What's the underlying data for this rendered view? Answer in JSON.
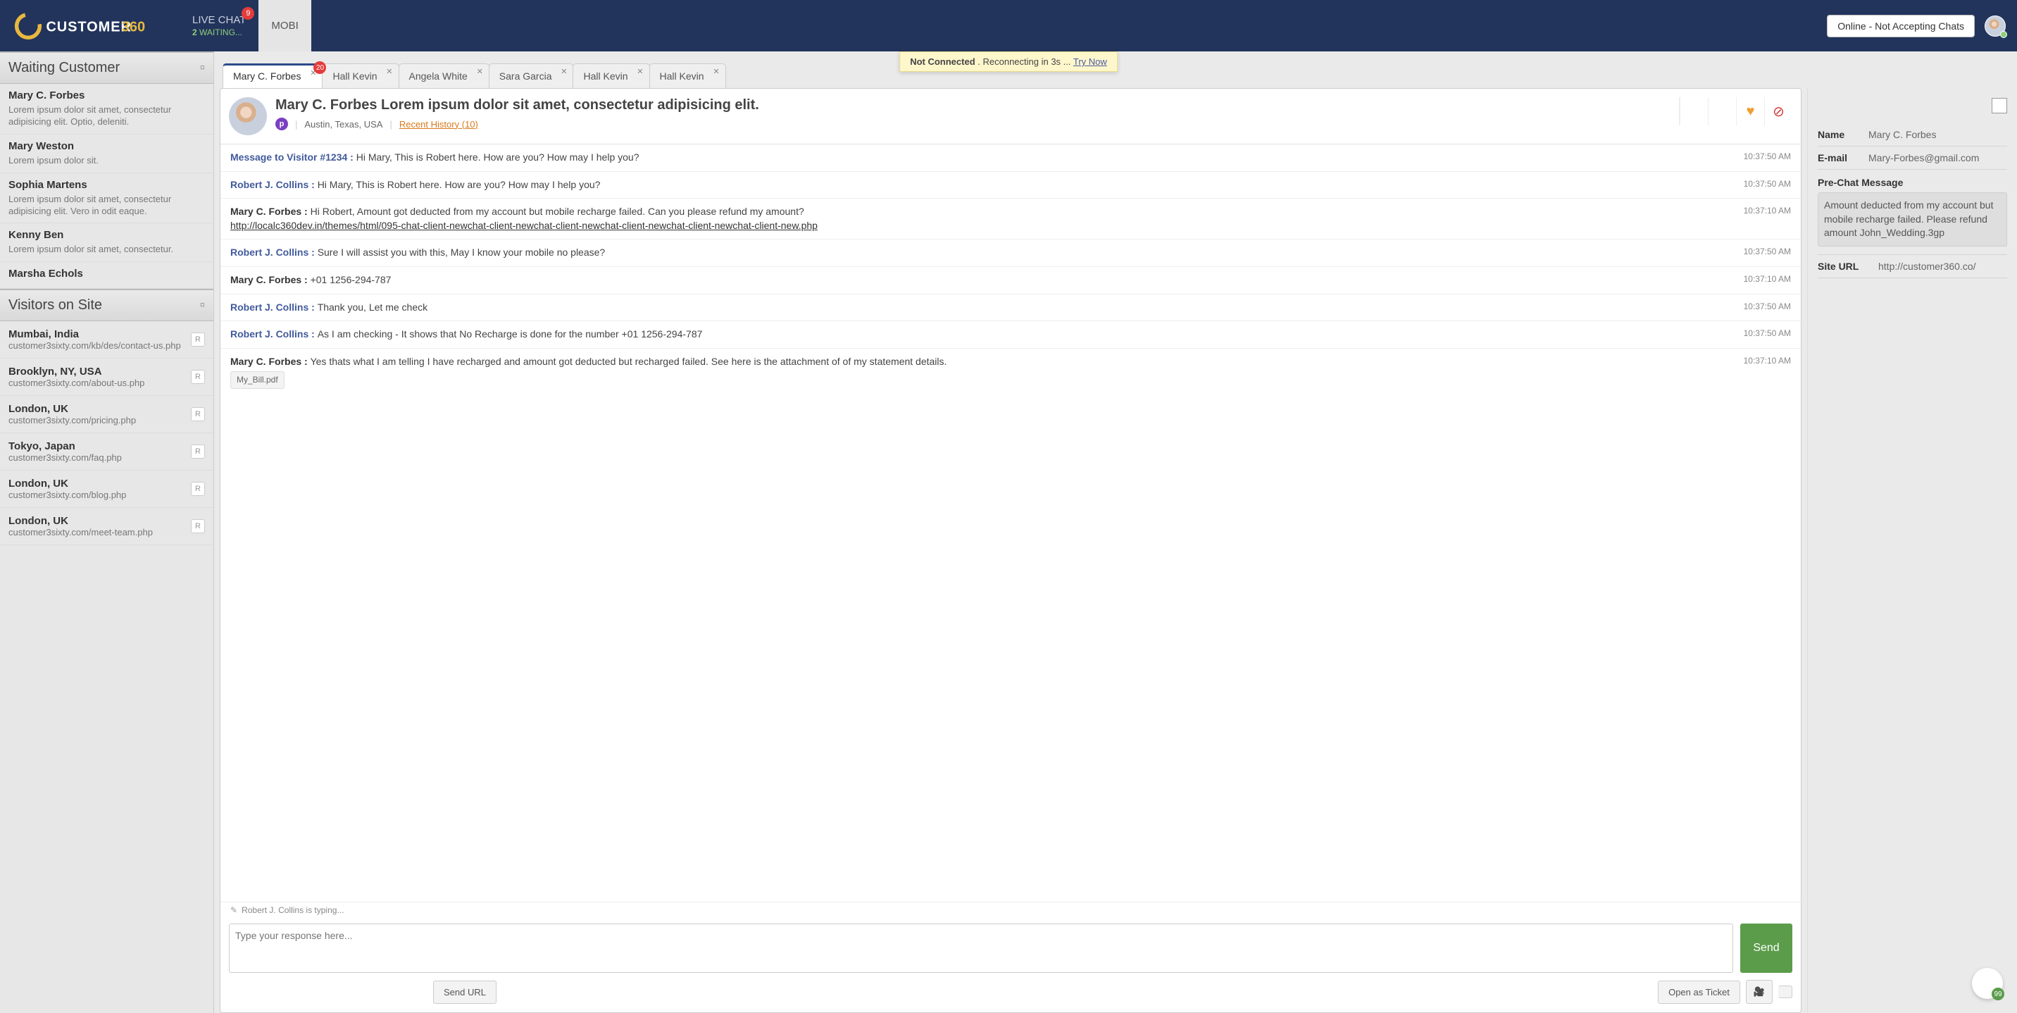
{
  "top": {
    "live_chat": "LIVE CHAT",
    "live_chat_badge": "9",
    "waiting_num": "2",
    "waiting_word": "Waiting...",
    "mobi": "MOBI",
    "status_btn": "Online - Not Accepting Chats"
  },
  "banner": {
    "nc": "Not Connected",
    "dot": " . ",
    "reconnect": "Reconnecting in 3s ... ",
    "try": "Try Now"
  },
  "side": {
    "waiting_title": "Waiting Customer",
    "visitors_title": "Visitors on Site"
  },
  "waiting": [
    {
      "name": "Mary C. Forbes",
      "desc": "Lorem ipsum dolor sit amet, consectetur adipisicing elit. Optio, deleniti."
    },
    {
      "name": "Mary Weston",
      "desc": "Lorem ipsum dolor sit."
    },
    {
      "name": "Sophia Martens",
      "desc": "Lorem ipsum dolor sit amet, consectetur adipisicing elit. Vero in odit eaque."
    },
    {
      "name": "Kenny Ben",
      "desc": "Lorem ipsum dolor sit amet, consectetur."
    },
    {
      "name": "Marsha Echols",
      "desc": ""
    }
  ],
  "visitors": [
    {
      "loc": "Mumbai, India",
      "url": "customer3sixty.com/kb/des/contact-us.php"
    },
    {
      "loc": "Brooklyn, NY, USA",
      "url": "customer3sixty.com/about-us.php"
    },
    {
      "loc": "London, UK",
      "url": "customer3sixty.com/pricing.php"
    },
    {
      "loc": "Tokyo, Japan",
      "url": "customer3sixty.com/faq.php"
    },
    {
      "loc": "London, UK",
      "url": "customer3sixty.com/blog.php"
    },
    {
      "loc": "London, UK",
      "url": "customer3sixty.com/meet-team.php"
    }
  ],
  "tabs": [
    {
      "label": "Mary C. Forbes",
      "badge": "20",
      "active": true
    },
    {
      "label": "Hall Kevin"
    },
    {
      "label": "Angela White"
    },
    {
      "label": "Sara Garcia"
    },
    {
      "label": "Hall Kevin"
    },
    {
      "label": "Hall Kevin"
    }
  ],
  "conv": {
    "title": "Mary C. Forbes Lorem ipsum dolor sit amet, consectetur adipisicing elit.",
    "location": "Austin, Texas, USA",
    "p": "p",
    "recent": "Recent History (10)",
    "typing": "Robert J. Collins is typing...",
    "placeholder": "Type your response here...",
    "send": "Send",
    "send_url": "Send URL",
    "open_ticket": "Open as Ticket"
  },
  "messages": [
    {
      "type": "sys",
      "who": "Message to Visitor #1234",
      "text": "Hi Mary, This is Robert here. How are you? How may I help you?",
      "time": "10:37:50 AM"
    },
    {
      "type": "agent",
      "who": "Robert J. Collins",
      "text": "Hi Mary, This is Robert here. How are you? How may I help you?",
      "time": "10:37:50 AM"
    },
    {
      "type": "cust",
      "who": "Mary C. Forbes",
      "text": "Hi Robert, Amount got deducted from my account but mobile recharge failed. Can you please refund my amount?",
      "link": "http://localc360dev.in/themes/html/095-chat-client-newchat-client-newchat-client-newchat-client-newchat-client-newchat-client-new.php",
      "time": "10:37:10 AM"
    },
    {
      "type": "agent",
      "who": "Robert J. Collins",
      "text": "Sure I will assist you with this, May I know your mobile no please?",
      "time": "10:37:50 AM"
    },
    {
      "type": "cust",
      "who": "Mary C. Forbes",
      "text": "+01 1256-294-787",
      "time": "10:37:10 AM"
    },
    {
      "type": "agent",
      "who": "Robert J. Collins",
      "text": "Thank you, Let me check",
      "time": "10:37:50 AM"
    },
    {
      "type": "agent",
      "who": "Robert J. Collins",
      "text": "As I am checking - It shows that No Recharge is done for the number +01 1256-294-787",
      "time": "10:37:50 AM"
    },
    {
      "type": "cust",
      "who": "Mary C. Forbes",
      "text": "Yes thats what I am telling I have recharged and amount got deducted but recharged failed. See here is the attachment of of my statement details.",
      "attach": "My_Bill.pdf",
      "time": "10:37:10 AM"
    }
  ],
  "details": {
    "name_label": "Name",
    "name_val": "Mary C. Forbes",
    "email_label": "E-mail",
    "email_val": "Mary-Forbes@gmail.com",
    "pre_label": "Pre-Chat Message",
    "pre_val": "Amount deducted from my account but mobile recharge failed. Please refund amount John_Wedding.3gp",
    "url_label": "Site URL",
    "url_val": "http://customer360.co/"
  },
  "fab": "99",
  "r": "R"
}
